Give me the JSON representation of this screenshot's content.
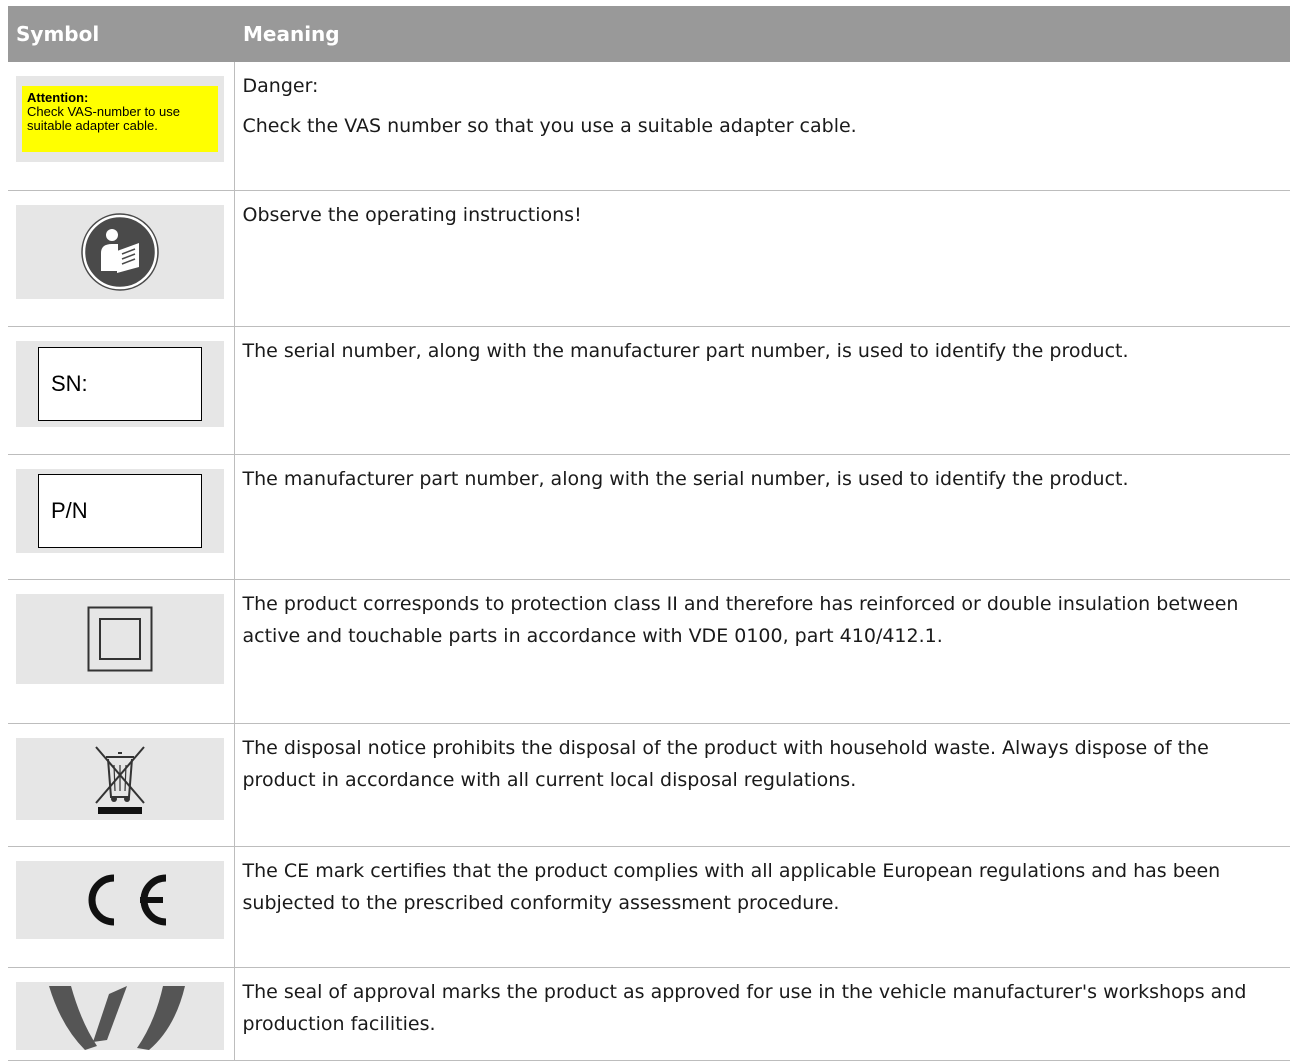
{
  "header": {
    "symbol": "Symbol",
    "meaning": "Meaning"
  },
  "rows": [
    {
      "icon": "attention-label-icon",
      "label_title": "Attention:",
      "label_line1": "Check VAS-number to use",
      "label_line2": "suitable adapter cable.",
      "meaning1": "Danger:",
      "meaning2": "Check the VAS number so that you use a suitable adapter cable."
    },
    {
      "icon": "operating-instructions-icon",
      "meaning1": "Observe the operating instructions!"
    },
    {
      "icon": "serial-number-label-icon",
      "label_text": "SN:",
      "meaning1": "The serial number, along with the manufacturer part number, is used to identify the product."
    },
    {
      "icon": "part-number-label-icon",
      "label_text": "P/N",
      "meaning1": "The manufacturer part number, along with the serial number, is used to identify the product."
    },
    {
      "icon": "protection-class-ii-icon",
      "meaning1": "The product corresponds to protection class II and therefore has reinforced or double insulation between active and touchable parts in accordance with VDE 0100, part 410/412.1."
    },
    {
      "icon": "weee-crossed-bin-icon",
      "meaning1": "The disposal notice prohibits the disposal of the product with household waste. Always dispose of the product in accordance with all current local disposal regulations."
    },
    {
      "icon": "ce-mark-icon",
      "meaning1": "The CE mark certifies that the product complies with all applicable European regulations and has been subjected to the prescribed conformity assessment procedure."
    },
    {
      "icon": "seal-of-approval-icon",
      "meaning1": "The seal of approval marks the product as approved for use in the vehicle manufacturer's workshops and production facilities."
    }
  ]
}
